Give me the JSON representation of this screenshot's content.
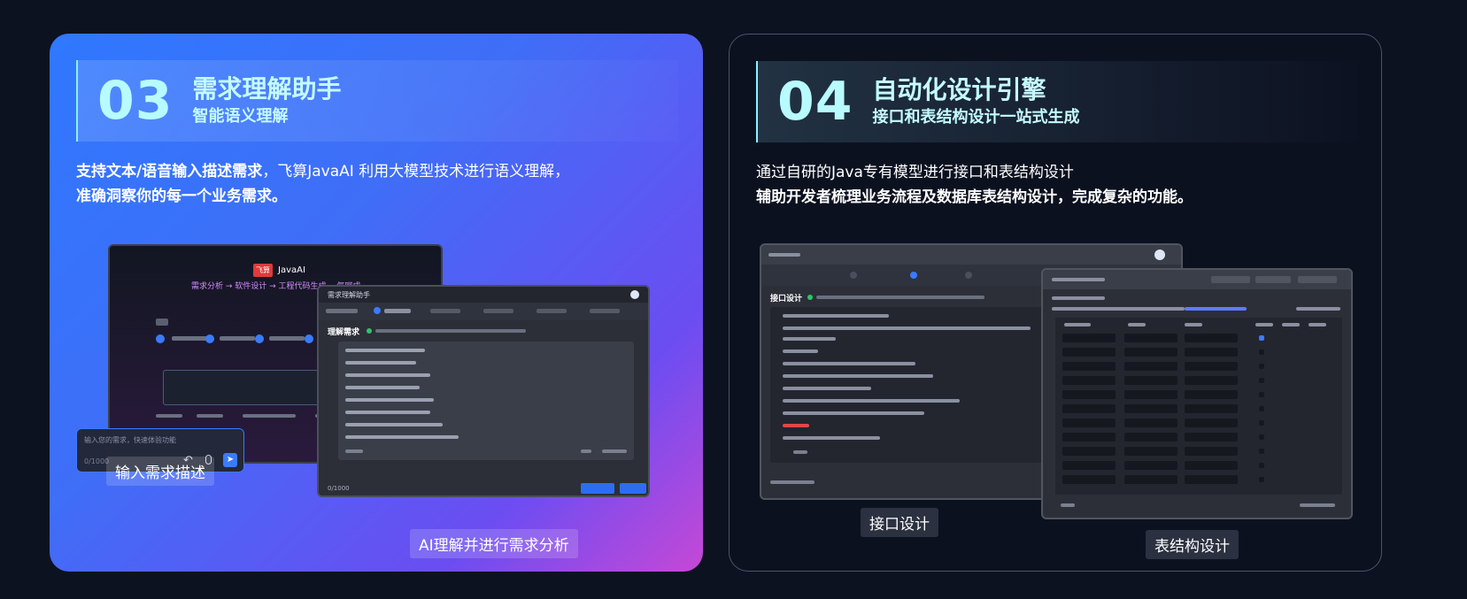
{
  "cards": [
    {
      "number": "03",
      "title": "需求理解助手",
      "subtitle": "智能语义理解",
      "desc_bold": "支持文本/语音输入描述需求",
      "desc_normal": "，飞算JavaAI 利用大模型技术进行语义理解，",
      "desc_line2": "准确洞察你的每一个业务需求。",
      "screenshot": {
        "logo_badge": "飞算",
        "logo_text": "JavaAI",
        "slogan": "需求分析 → 软件设计 → 工程代码生成  一气呵成",
        "input_placeholder": "输入您的需求，快速体验功能",
        "input_counter": "0/1000",
        "panel_title": "需求理解助手",
        "section_label": "理解需求",
        "counter2": "0/1000"
      },
      "captions": [
        "输入需求描述",
        "AI理解并进行需求分析"
      ]
    },
    {
      "number": "04",
      "title": "自动化设计引擎",
      "subtitle": "接口和表结构设计一站式生成",
      "desc_line1": "通过自研的Java专有模型进行接口和表结构设计",
      "desc_line2": "辅助开发者梳理业务流程及数据库表结构设计，完成复杂的功能。",
      "screenshot": {
        "section_label": "接口设计"
      },
      "captions": [
        "接口设计",
        "表结构设计"
      ]
    }
  ],
  "colors": {
    "accent_cyan": "#b8fbff",
    "card_gradient_start": "#2f78ff",
    "card_gradient_end": "#c648d6",
    "page_bg": "#0d1220"
  }
}
